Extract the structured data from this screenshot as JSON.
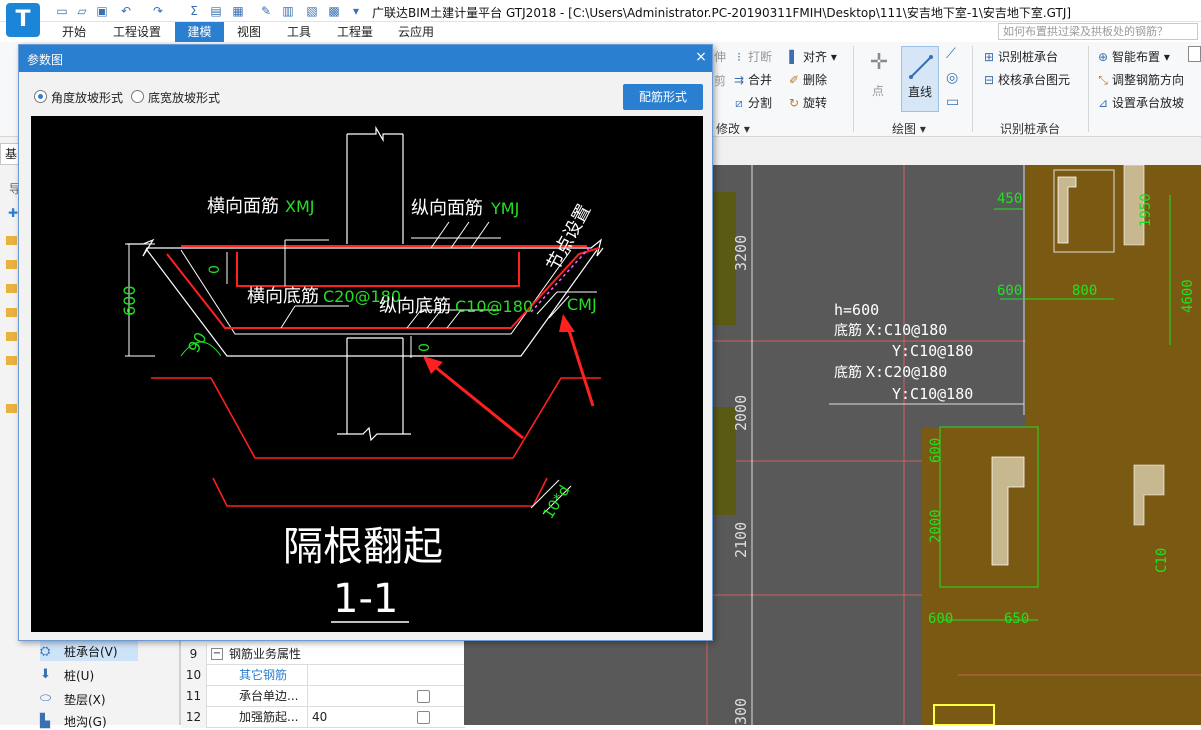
{
  "window": {
    "logo": "T",
    "title": "广联达BIM土建计量平台 GTJ2018 - [C:\\Users\\Administrator.PC-20190311FMIH\\Desktop\\111\\安吉地下室-1\\安吉地下室.GTJ]"
  },
  "menu": {
    "tabs": [
      "开始",
      "工程设置",
      "建模",
      "视图",
      "工具",
      "工程量",
      "云应用"
    ],
    "active": "建模",
    "help_placeholder": "如何布置拱过梁及拱板处的钢筋？"
  },
  "ribbon": {
    "modify": {
      "items": [
        "打断",
        "对齐",
        "合并",
        "删除",
        "分割",
        "旋转"
      ],
      "partial": [
        "伸",
        "剪"
      ],
      "label": "修改"
    },
    "draw": {
      "point": "点",
      "line": "直线",
      "label": "绘图"
    },
    "identify": {
      "items": [
        "识别桩承台",
        "校核承台图元"
      ],
      "label": "识别桩承台"
    },
    "smart": {
      "items": [
        "智能布置",
        "调整钢筋方向",
        "设置承台放坡"
      ]
    }
  },
  "left_panel": {
    "tab_partial": "基",
    "nav_partial": "导",
    "items": [
      {
        "label": "桩承台(V)",
        "selected": true,
        "icon": "pile-cap-icon"
      },
      {
        "label": "桩(U)",
        "selected": false,
        "icon": "pile-icon"
      },
      {
        "label": "垫层(X)",
        "selected": false,
        "icon": "cushion-icon"
      },
      {
        "label": "地沟(G)",
        "selected": false,
        "icon": "trench-icon"
      }
    ]
  },
  "property_grid": {
    "rows": [
      {
        "num": "9",
        "name": "钢筋业务属性",
        "value": "",
        "expand": "−",
        "checkbox": false
      },
      {
        "num": "10",
        "name": "其它钢筋",
        "value": "",
        "link": true,
        "checkbox": false
      },
      {
        "num": "11",
        "name": "承台单边...",
        "value": "",
        "checkbox": true
      },
      {
        "num": "12",
        "name": "加强筋起...",
        "value": "40",
        "checkbox": true
      }
    ]
  },
  "dialog": {
    "title": "参数图",
    "close": "×",
    "radios": [
      {
        "label": "角度放坡形式",
        "checked": true
      },
      {
        "label": "底宽放坡形式",
        "checked": false
      }
    ],
    "rebar_button": "配筋形式",
    "drawing": {
      "top_bar_label": "横向面筋",
      "top_bar_code": "XMJ",
      "long_top_label": "纵向面筋",
      "long_top_code": "YMJ",
      "node_label": "节点设置",
      "side_code": "CMJ",
      "bottom_bar_label": "横向底筋",
      "bottom_bar_code": "C20@180",
      "long_bottom_label": "纵向底筋",
      "long_bottom_code": "C10@180",
      "height_dim": "600",
      "zero_a": "0",
      "zero_b": "0",
      "angle": "90",
      "anchor": "10*d",
      "caption": "隔根翻起",
      "section": "1-1"
    }
  },
  "canvas": {
    "dims": [
      "3200",
      "2000",
      "2100",
      "300",
      "450",
      "1950",
      "600",
      "800",
      "4600",
      "600",
      "2000",
      "600",
      "650",
      "C10"
    ],
    "annotation": {
      "h": "h=600",
      "line1": "X:C10@180",
      "line2": "Y:C10@180",
      "line3": "X:C20@180",
      "line4": "Y:C10@180",
      "prefix": "底筋"
    }
  },
  "colors": {
    "accent": "#2b7fd1",
    "drawing_bg": "#000000",
    "rebar_red": "#ff2020",
    "dim_green": "#22e022",
    "canvas_bg": "#595959",
    "cap_fill": "#7a5a12"
  }
}
